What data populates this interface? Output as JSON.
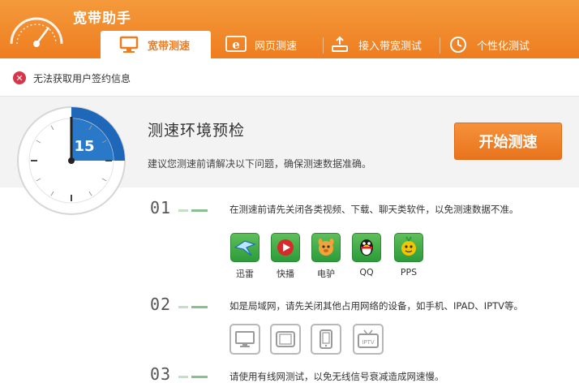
{
  "app": {
    "title": "宽带助手"
  },
  "tabs": [
    {
      "label": "宽带测速",
      "icon": "monitor-icon",
      "active": true
    },
    {
      "label": "网页测速",
      "icon": "ie-browser-icon",
      "active": false
    },
    {
      "label": "接入带宽测试",
      "icon": "router-icon",
      "active": false
    },
    {
      "label": "个性化测试",
      "icon": "clock-icon",
      "active": false
    }
  ],
  "alert": {
    "text": "无法获取用户签约信息",
    "icon": "error-icon"
  },
  "precheck": {
    "countdown": "15",
    "title": "测速环境预检",
    "description": "建议您测速前请解决以下问题，确保测速数据准确。",
    "start_button": "开始测速"
  },
  "steps": [
    {
      "number": "01",
      "text": "在测速前请先关闭各类视频、下载、聊天类软件，以免测速数据不准。",
      "apps": [
        {
          "label": "迅雷",
          "icon": "xunlei-icon"
        },
        {
          "label": "快播",
          "icon": "qvod-icon"
        },
        {
          "label": "电驴",
          "icon": "emule-icon"
        },
        {
          "label": "QQ",
          "icon": "qq-icon"
        },
        {
          "label": "PPS",
          "icon": "pps-icon"
        }
      ]
    },
    {
      "number": "02",
      "text": "如是局域网，请先关闭其他占用网络的设备，如手机、IPAD、IPTV等。",
      "devices": [
        {
          "icon": "monitor-device-icon"
        },
        {
          "icon": "tablet-device-icon"
        },
        {
          "icon": "phone-device-icon"
        },
        {
          "icon": "iptv-device-icon",
          "label": "IPTV"
        }
      ]
    },
    {
      "number": "03",
      "text": "请使用有线网测试，以免无线信号衰减造成网速慢。"
    }
  ],
  "colors": {
    "header_orange": "#ee7d1f",
    "accent_blue": "#1f67b8",
    "alert_red": "#d8344a",
    "app_green": "#2c9b3a"
  }
}
